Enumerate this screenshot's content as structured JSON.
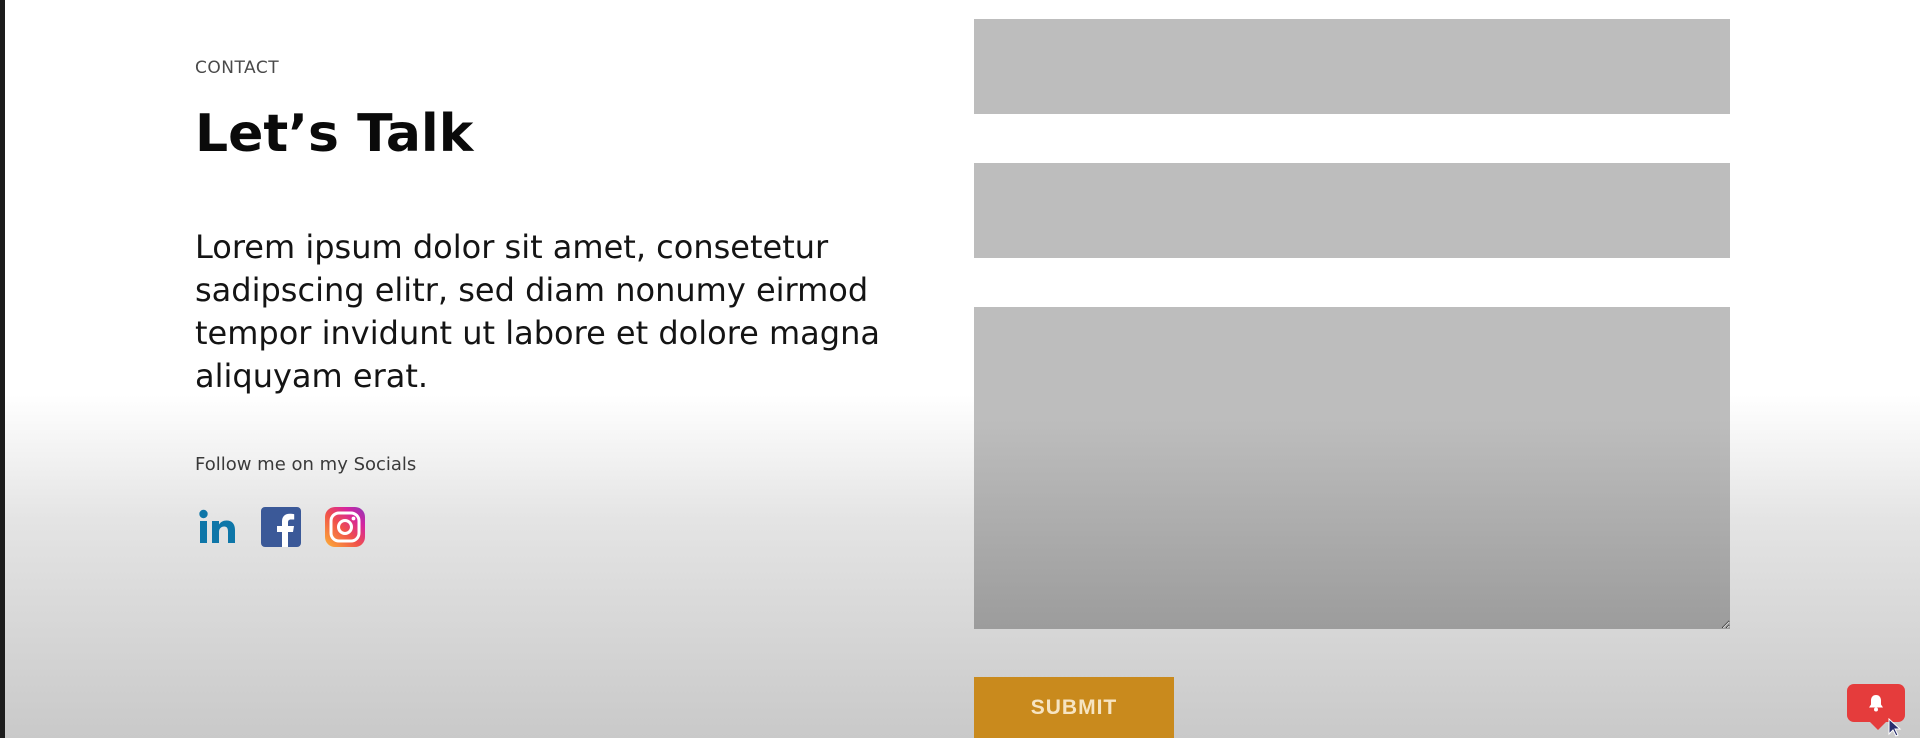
{
  "contact": {
    "eyebrow": "CONTACT",
    "title": "Let’s Talk",
    "body": "Lorem ipsum dolor sit amet, consetetur sadipscing elitr, sed diam nonumy eirmod tempor invidunt ut labore et dolore magna aliquyam erat.",
    "social_label": "Follow me on my Socials",
    "socials": [
      {
        "name": "LinkedIn",
        "icon": "linkedin-icon",
        "color": "#0e76a8"
      },
      {
        "name": "Facebook",
        "icon": "facebook-icon",
        "color": "#3b5998"
      },
      {
        "name": "Instagram",
        "icon": "instagram-icon",
        "color": "#d6249f"
      }
    ]
  },
  "form": {
    "field_color": "#bdbdbd",
    "submit_label": "SUBMIT",
    "submit_color": "#c98a1d"
  },
  "notification": {
    "icon": "bell-icon",
    "color": "#e53c3c"
  }
}
